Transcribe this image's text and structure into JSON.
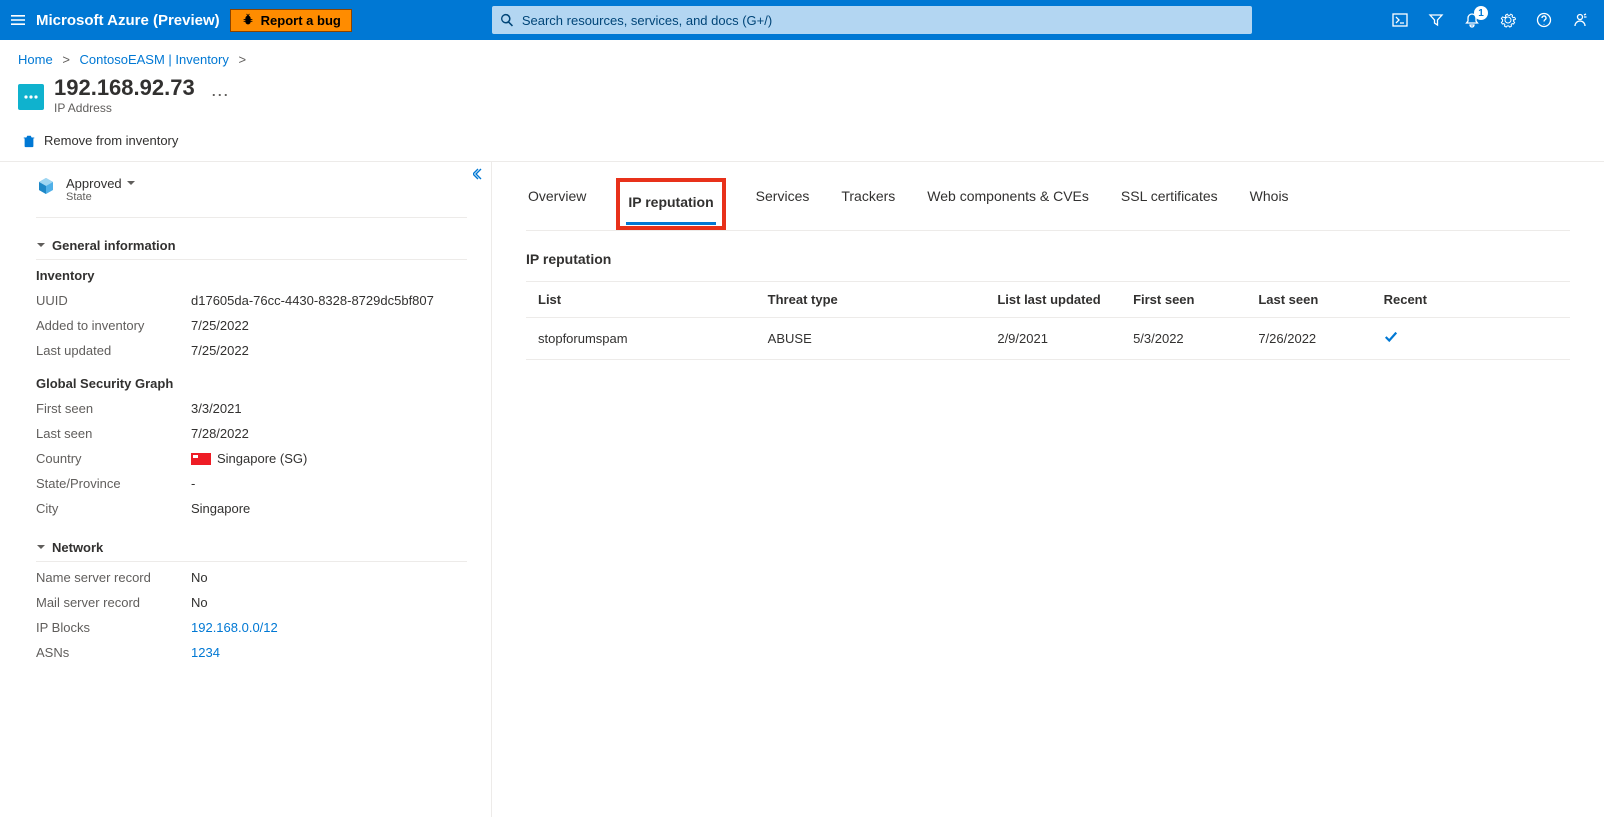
{
  "header": {
    "brand": "Microsoft Azure (Preview)",
    "bug_label": "Report a bug",
    "search_placeholder": "Search resources, services, and docs (G+/)",
    "badge_count": "1"
  },
  "breadcrumb": {
    "items": [
      "Home",
      "ContosoEASM | Inventory"
    ]
  },
  "page": {
    "title": "192.168.92.73",
    "subtitle": "IP Address",
    "remove_label": "Remove from inventory"
  },
  "state": {
    "value": "Approved",
    "label": "State"
  },
  "left": {
    "general_header": "General information",
    "network_header": "Network",
    "inventory_header": "Inventory",
    "graph_header": "Global Security Graph",
    "inventory": {
      "uuid_k": "UUID",
      "uuid_v": "d17605da-76cc-4430-8328-8729dc5bf807",
      "added_k": "Added to inventory",
      "added_v": "7/25/2022",
      "updated_k": "Last updated",
      "updated_v": "7/25/2022"
    },
    "graph": {
      "first_k": "First seen",
      "first_v": "3/3/2021",
      "last_k": "Last seen",
      "last_v": "7/28/2022",
      "country_k": "Country",
      "country_v": "Singapore (SG)",
      "state_k": "State/Province",
      "state_v": "-",
      "city_k": "City",
      "city_v": "Singapore"
    },
    "network": {
      "ns_k": "Name server record",
      "ns_v": "No",
      "mail_k": "Mail server record",
      "mail_v": "No",
      "block_k": "IP Blocks",
      "block_v": "192.168.0.0/12",
      "asn_k": "ASNs",
      "asn_v": "1234"
    }
  },
  "tabs": {
    "overview": "Overview",
    "ip_rep": "IP reputation",
    "services": "Services",
    "trackers": "Trackers",
    "webcomp": "Web components & CVEs",
    "ssl": "SSL certificates",
    "whois": "Whois"
  },
  "panel": {
    "title": "IP reputation",
    "columns": {
      "list": "List",
      "threat": "Threat type",
      "updated": "List last updated",
      "first": "First seen",
      "last": "Last seen",
      "recent": "Recent"
    },
    "rows": [
      {
        "list": "stopforumspam",
        "threat": "ABUSE",
        "updated": "2/9/2021",
        "first": "5/3/2022",
        "last": "7/26/2022",
        "recent": true
      }
    ]
  }
}
